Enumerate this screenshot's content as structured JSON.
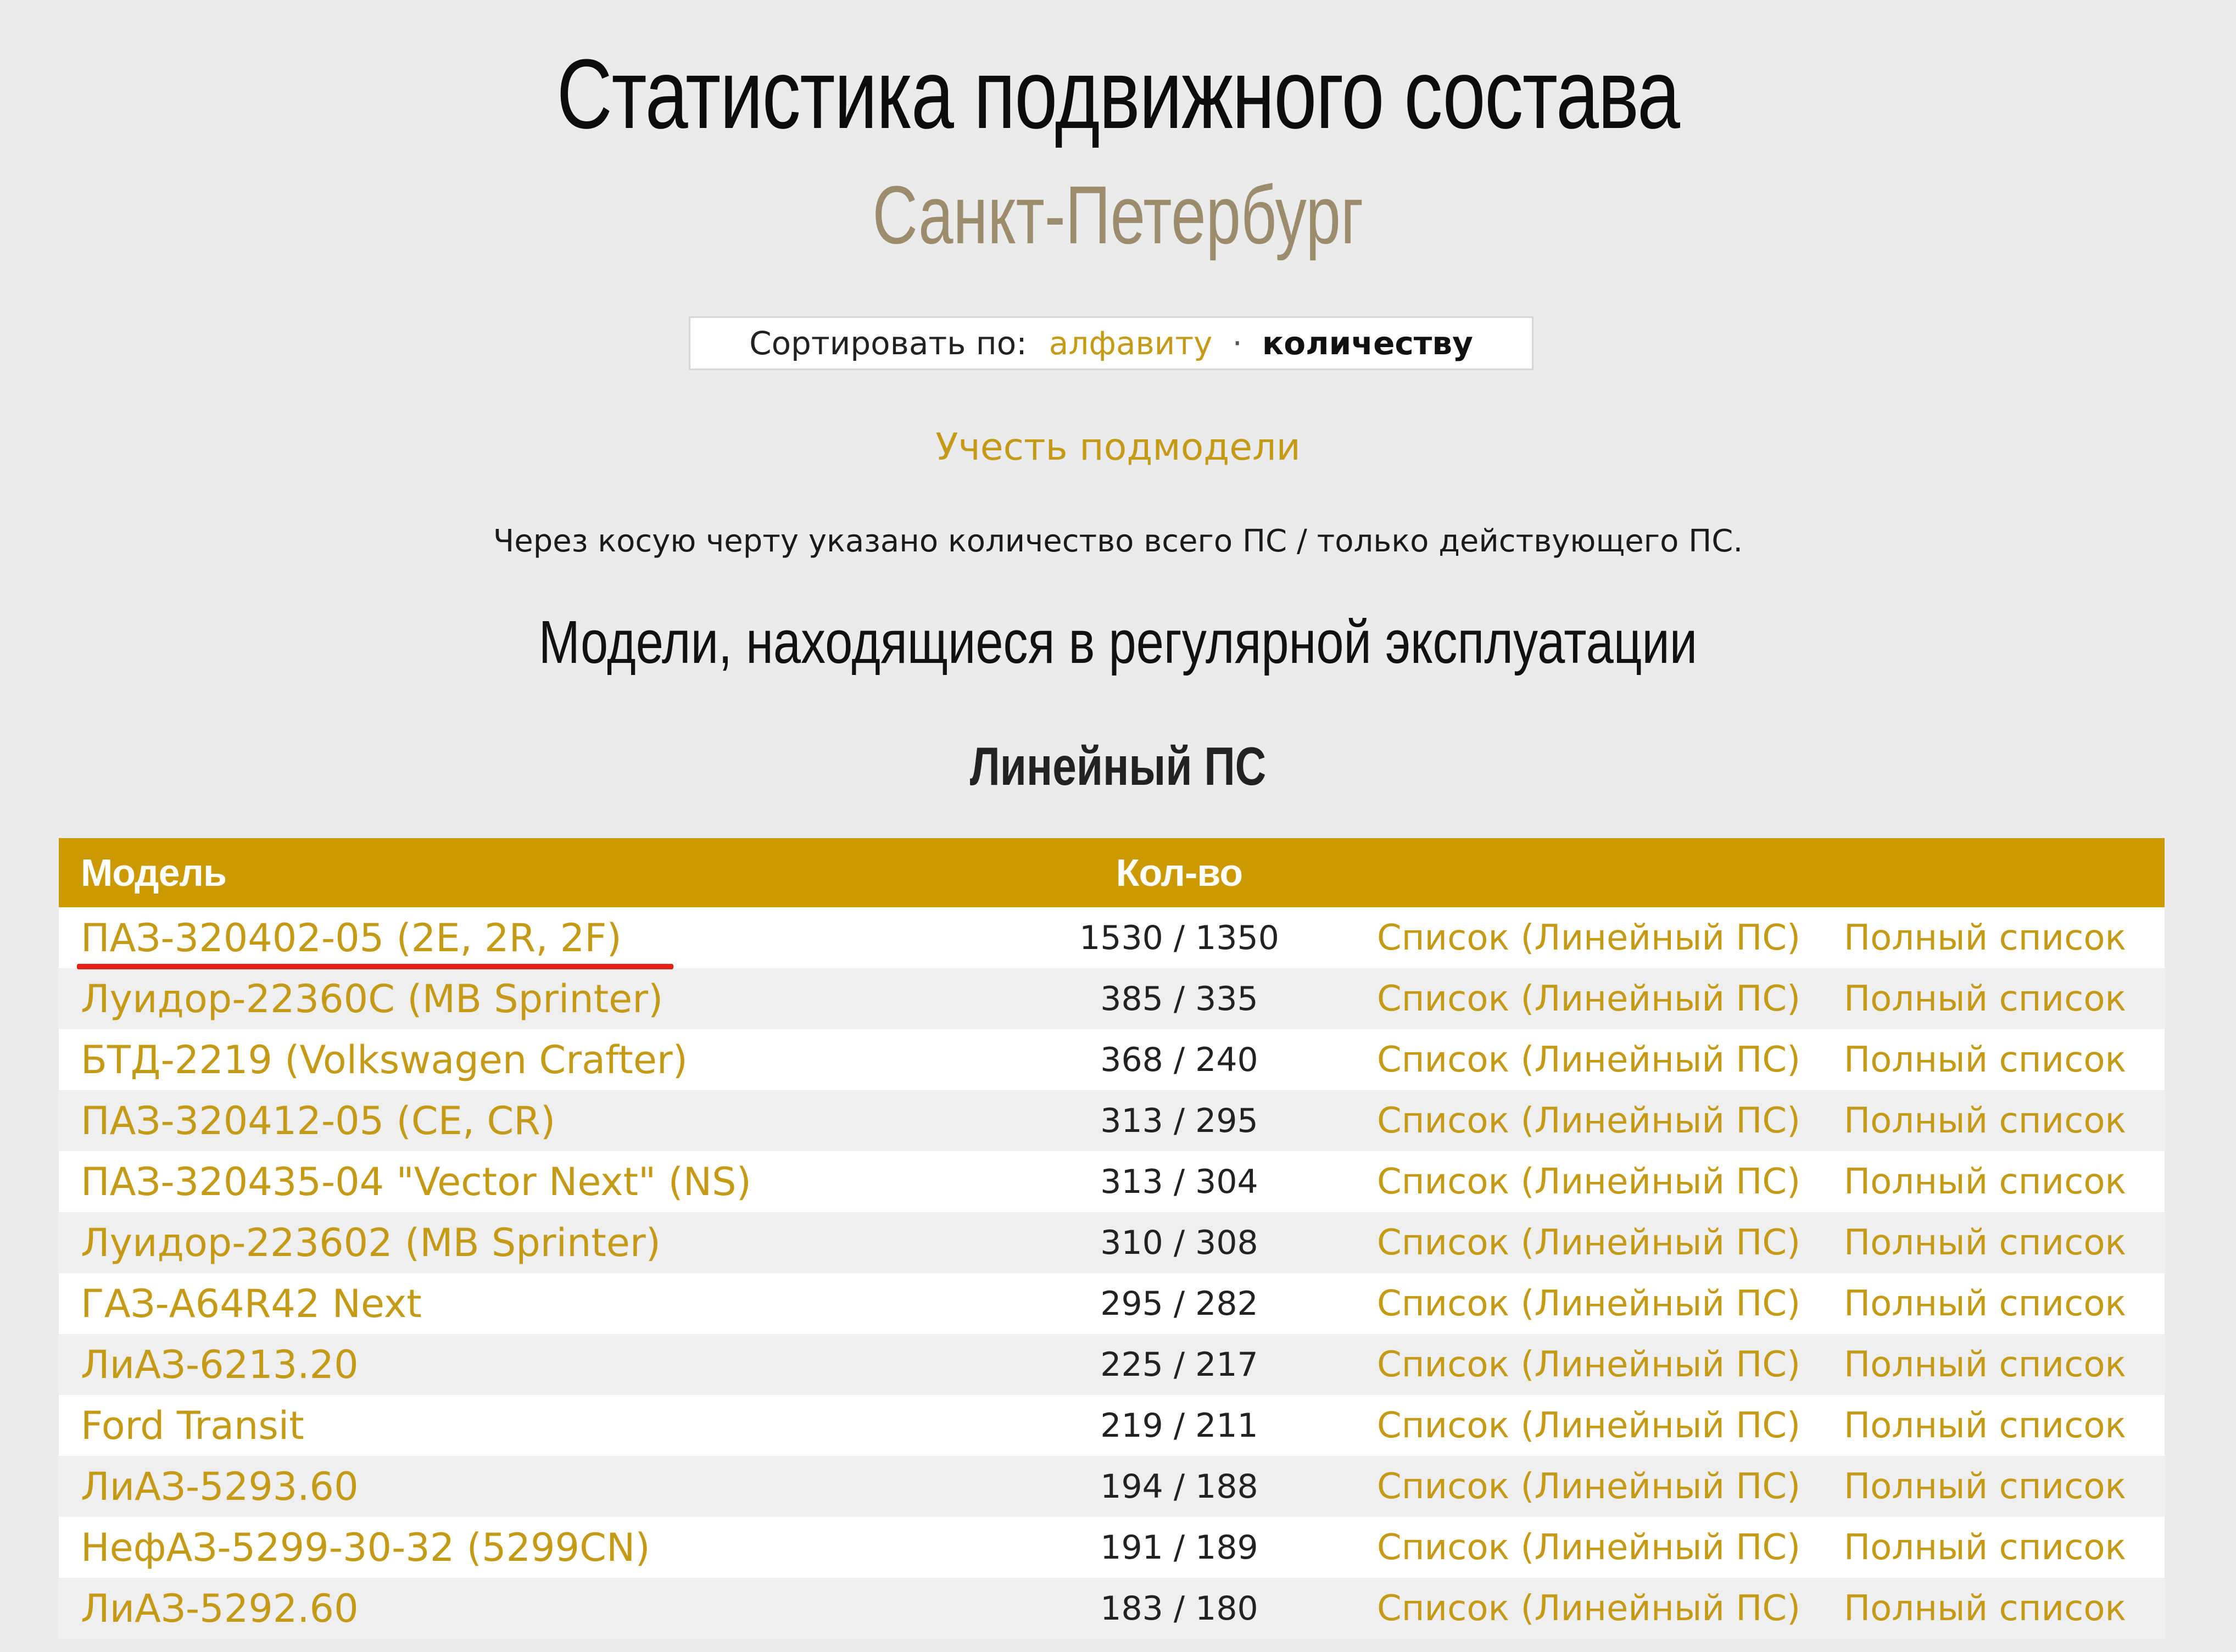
{
  "header": {
    "title": "Статистика подвижного состава",
    "city": "Санкт-Петербург"
  },
  "sort": {
    "label": "Сортировать по:",
    "by_alphabet": "алфавиту",
    "separator": "·",
    "by_count": "количеству"
  },
  "submodels_link": "Учесть подмодели",
  "note": "Через косую черту указано количество всего ПС / только действующего ПС.",
  "section_title": "Модели, находящиеся в регулярной эксплуатации",
  "subsection_title": "Линейный ПС",
  "table": {
    "headers": {
      "model": "Модель",
      "count": "Кол-во",
      "list": "",
      "full": ""
    },
    "rows": [
      {
        "model": "ПАЗ-320402-05 (2E, 2R, 2F)",
        "count": "1530 / 1350",
        "list": "Список (Линейный ПС)",
        "full": "Полный список"
      },
      {
        "model": "Луидор-22360C (MB Sprinter)",
        "count": "385 / 335",
        "list": "Список (Линейный ПС)",
        "full": "Полный список"
      },
      {
        "model": "БТД-2219 (Volkswagen Crafter)",
        "count": "368 / 240",
        "list": "Список (Линейный ПС)",
        "full": "Полный список"
      },
      {
        "model": "ПАЗ-320412-05 (CE, CR)",
        "count": "313 / 295",
        "list": "Список (Линейный ПС)",
        "full": "Полный список"
      },
      {
        "model": "ПАЗ-320435-04 \"Vector Next\" (NS)",
        "count": "313 / 304",
        "list": "Список (Линейный ПС)",
        "full": "Полный список"
      },
      {
        "model": "Луидор-223602 (MB Sprinter)",
        "count": "310 / 308",
        "list": "Список (Линейный ПС)",
        "full": "Полный список"
      },
      {
        "model": "ГАЗ-A64R42 Next",
        "count": "295 / 282",
        "list": "Список (Линейный ПС)",
        "full": "Полный список"
      },
      {
        "model": "ЛиАЗ-6213.20",
        "count": "225 / 217",
        "list": "Список (Линейный ПС)",
        "full": "Полный список"
      },
      {
        "model": "Ford Transit",
        "count": "219 / 211",
        "list": "Список (Линейный ПС)",
        "full": "Полный список"
      },
      {
        "model": "ЛиАЗ-5293.60",
        "count": "194 / 188",
        "list": "Список (Линейный ПС)",
        "full": "Полный список"
      },
      {
        "model": "НефАЗ-5299-30-32 (5299CN)",
        "count": "191 / 189",
        "list": "Список (Линейный ПС)",
        "full": "Полный список"
      },
      {
        "model": "ЛиАЗ-5292.60",
        "count": "183 / 180",
        "list": "Список (Линейный ПС)",
        "full": "Полный список"
      }
    ]
  },
  "colors": {
    "background": "#ebebeb",
    "accent": "#c49a16",
    "header_bg": "#cc9900",
    "subtitle": "#9d8c6c",
    "annotation_underline": "#e0241b"
  }
}
